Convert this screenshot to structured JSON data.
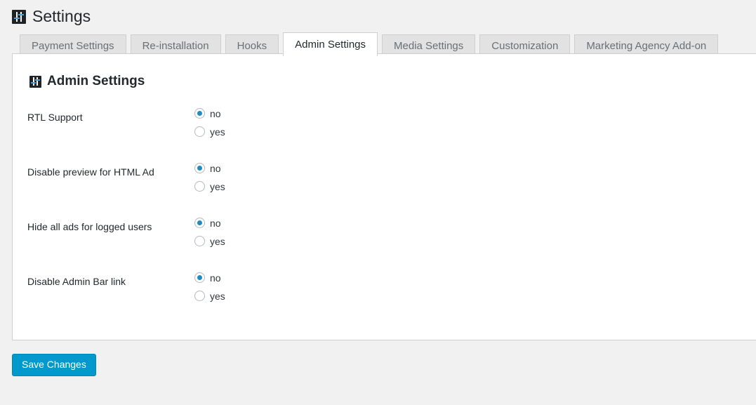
{
  "header": {
    "title": "Settings",
    "icon": "sliders-icon"
  },
  "tabs": [
    {
      "label": "Payment Settings",
      "active": false
    },
    {
      "label": "Re-installation",
      "active": false
    },
    {
      "label": "Hooks",
      "active": false
    },
    {
      "label": "Admin Settings",
      "active": true
    },
    {
      "label": "Media Settings",
      "active": false
    },
    {
      "label": "Customization",
      "active": false
    },
    {
      "label": "Marketing Agency Add-on",
      "active": false
    }
  ],
  "panel": {
    "heading": "Admin Settings",
    "icon": "sliders-icon",
    "rows": [
      {
        "label": "RTL Support",
        "options": [
          {
            "label": "no",
            "checked": true
          },
          {
            "label": "yes",
            "checked": false
          }
        ]
      },
      {
        "label": "Disable preview for HTML Ad",
        "options": [
          {
            "label": "no",
            "checked": true
          },
          {
            "label": "yes",
            "checked": false
          }
        ]
      },
      {
        "label": "Hide all ads for logged users",
        "options": [
          {
            "label": "no",
            "checked": true
          },
          {
            "label": "yes",
            "checked": false
          }
        ]
      },
      {
        "label": "Disable Admin Bar link",
        "options": [
          {
            "label": "no",
            "checked": true
          },
          {
            "label": "yes",
            "checked": false
          }
        ]
      }
    ]
  },
  "footer": {
    "save_label": "Save Changes"
  },
  "colors": {
    "accent": "#0099cc",
    "radio_dot": "#1e8cbe",
    "page_bg": "#f1f1f1",
    "panel_bg": "#ffffff",
    "tab_bg": "#e2e2e2",
    "border": "#cfcfcf",
    "text": "#23282d",
    "tab_text": "#6b6f73"
  }
}
